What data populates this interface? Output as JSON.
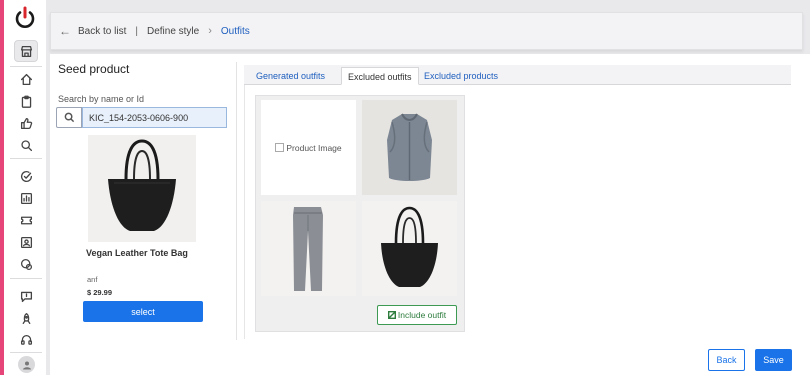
{
  "breadcrumb": {
    "back": "Back to list",
    "separator": "|",
    "step": "Define style",
    "current": "Outfits"
  },
  "seed": {
    "title": "Seed product",
    "search_label": "Search by name or Id",
    "search_value": "KIC_154-2053-0606-900",
    "product_name": "Vegan Leather Tote Bag",
    "brand": "anf",
    "price": "$ 29.99",
    "select_label": "select"
  },
  "tabs": [
    {
      "label": "Generated outfits",
      "active": false
    },
    {
      "label": "Excluded outfits",
      "active": true
    },
    {
      "label": "Excluded products",
      "active": false
    }
  ],
  "outfit": {
    "broken_image_alt": "Product Image",
    "include_label": "Include outfit"
  },
  "footer": {
    "back_label": "Back",
    "save_label": "Save"
  },
  "icons": {
    "rail": [
      "store-icon",
      "home-icon",
      "clipboard-icon",
      "thumbs-up-icon",
      "search-icon",
      "check-circle-icon",
      "chart-icon",
      "ticket-icon",
      "id-card-icon",
      "tag-icon",
      "chat-icon",
      "rocket-icon",
      "support-icon",
      "user-icon"
    ]
  },
  "colors": {
    "accent": "#1a73e8",
    "rail_stripe": "#e6457a",
    "logo_red": "#d8262c",
    "include_green": "#2e7d3e"
  }
}
